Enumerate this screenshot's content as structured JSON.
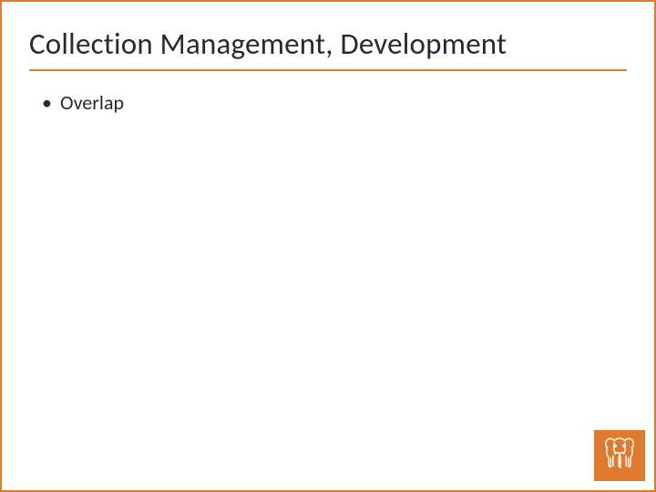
{
  "slide": {
    "title": "Collection Management, Development",
    "bullets": [
      "Overlap"
    ]
  },
  "colors": {
    "accent": "#e07a2e",
    "text": "#2a2a2a"
  },
  "logo": {
    "name": "elephant-icon"
  }
}
